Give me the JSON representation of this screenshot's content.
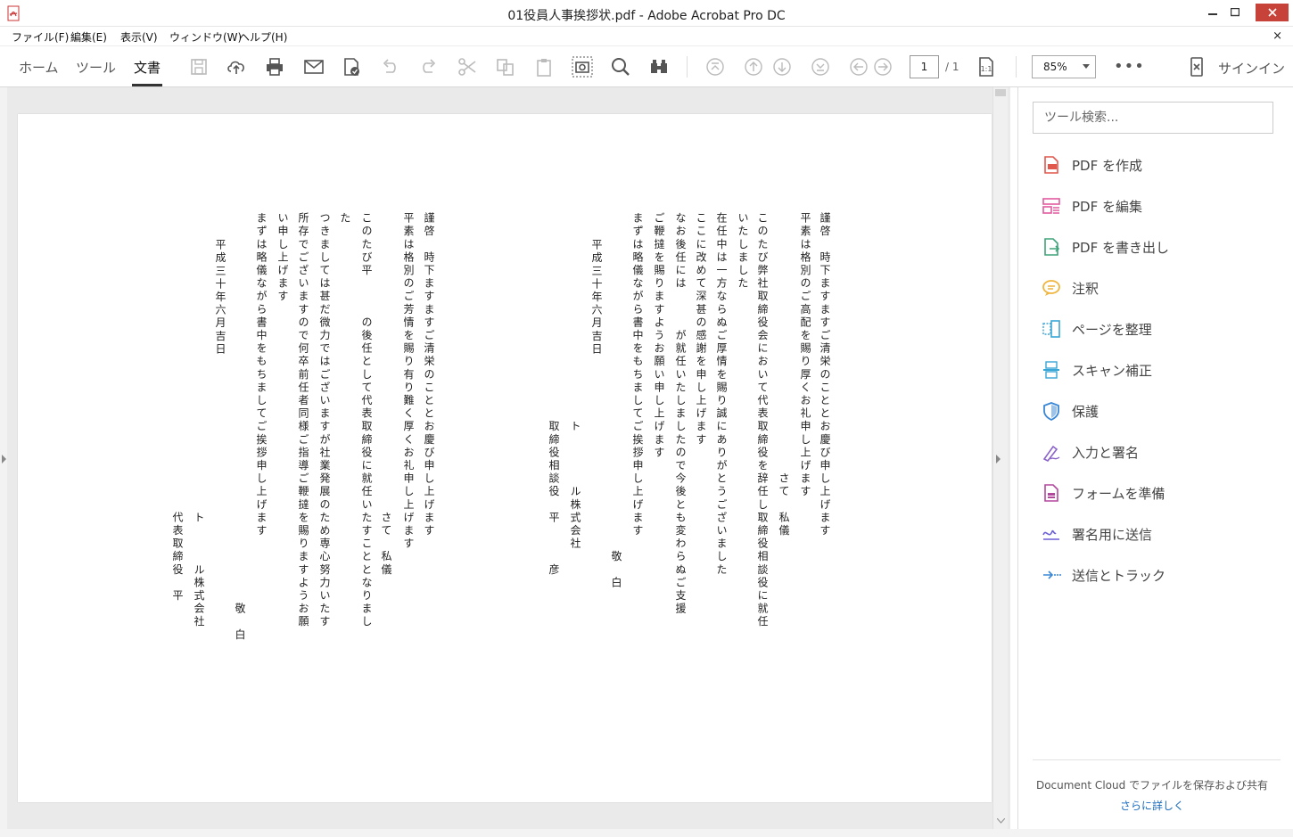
{
  "window": {
    "title": "01役員人事挨拶状.pdf - Adobe Acrobat Pro DC",
    "close_glyph": "✕"
  },
  "menu": {
    "items": [
      "ファイル(F)",
      "編集(E)",
      "表示(V)",
      "ウィンドウ(W)",
      "ヘルプ(H)"
    ],
    "close_glyph": "×"
  },
  "toolbar": {
    "tabs": [
      "ホーム",
      "ツール",
      "文書"
    ],
    "active_tab": "文書",
    "page_current": "1",
    "page_total": "/ 1",
    "zoom": "85%",
    "more": "•••",
    "signin_label": "サインイン",
    "icons": [
      "save-icon",
      "upload-icon",
      "print-icon",
      "email-icon",
      "spellcheck-icon",
      "undo-icon",
      "redo-icon",
      "cut-icon",
      "copy-icon",
      "paste-icon",
      "snapshot-icon",
      "search-icon",
      "find-icon",
      "first-page-icon",
      "prev-page-icon",
      "next-page-icon",
      "last-page-icon",
      "back-icon",
      "forward-icon",
      "fit-page-icon",
      "mobile-icon"
    ]
  },
  "document": {
    "columns": [
      "謹啓　時下ますますご清栄のこととお慶び申し上げます",
      "平素は格別のご高配を賜り厚くお礼申し上げます",
      "　　　　　　　　　　　　　　　　　　　　さて　私儀",
      "このたび弊社取締役会において代表取締役を辞任し取締役相談役に就任",
      "いたしました",
      "在任中は一方ならぬご厚情を賜り誠にありがとうございました",
      "ここに改めて深甚の感謝を申し上げます",
      "なお後任には　　　が就任いたしましたので今後とも変わらぬご支援",
      "ご鞭撻を賜りますようお願い申し上げます",
      "まずは略儀ながら書中をもちましてご挨拶申し上げます",
      "　　　　　　　　　　　　　　　　　　　　　　　　　　敬　白",
      "平成三十年六月吉日",
      "　　　　　　　　　　　　　　　　ト　　　　ル株式会社",
      "　　　　　　　　　　　　　　　　取締役相談役　平　　　彦",
      "謹啓　時下ますますご清栄のこととお慶び申し上げます",
      "平素は格別のご芳情を賜り有り難く厚くお礼申し上げます",
      "　　　　　　　　　　　　　　　　　　　　　　　さて　私儀",
      "このたび平　　　の後任として代表取締役に就任いたすこととなりまし",
      "た",
      "つきましては甚だ微力ではございますが社業発展のため専心努力いたす",
      "所存でございますので何卒前任者同様ご指導ご鞭撻を賜りますようお願",
      "い申し上げます",
      "まずは略儀ながら書中をもちましてご挨拶申し上げます",
      "　　　　　　　　　　　　　　　　　　　　　　　　　　　　　　敬　白",
      "平成三十年六月吉日",
      "　　　　　　　　　　　　　　　　　　　　　　　ト　　　ル株式会社",
      "　　　　　　　　　　　　　　　　　　　　　　　代表取締役　平"
    ]
  },
  "panel": {
    "search_placeholder": "ツール検索...",
    "tools": [
      {
        "label": "PDF を作成",
        "icon": "create-pdf-icon",
        "color": "#e2574c"
      },
      {
        "label": "PDF を編集",
        "icon": "edit-pdf-icon",
        "color": "#e15a9f"
      },
      {
        "label": "PDF を書き出し",
        "icon": "export-pdf-icon",
        "color": "#3fa37a"
      },
      {
        "label": "注釈",
        "icon": "comment-icon",
        "color": "#f0b43c"
      },
      {
        "label": "ページを整理",
        "icon": "organize-pages-icon",
        "color": "#3aa6d6"
      },
      {
        "label": "スキャン補正",
        "icon": "scan-icon",
        "color": "#3aa6d6"
      },
      {
        "label": "保護",
        "icon": "protect-icon",
        "color": "#3a87d6"
      },
      {
        "label": "入力と署名",
        "icon": "fill-sign-icon",
        "color": "#8a63c9"
      },
      {
        "label": "フォームを準備",
        "icon": "prepare-form-icon",
        "color": "#b4479d"
      },
      {
        "label": "署名用に送信",
        "icon": "send-for-signature-icon",
        "color": "#6b5fd6"
      },
      {
        "label": "送信とトラック",
        "icon": "send-track-icon",
        "color": "#3a87d6"
      }
    ],
    "dc_text": "Document Cloud でファイルを保存および共有",
    "dc_link": "さらに詳しく"
  }
}
